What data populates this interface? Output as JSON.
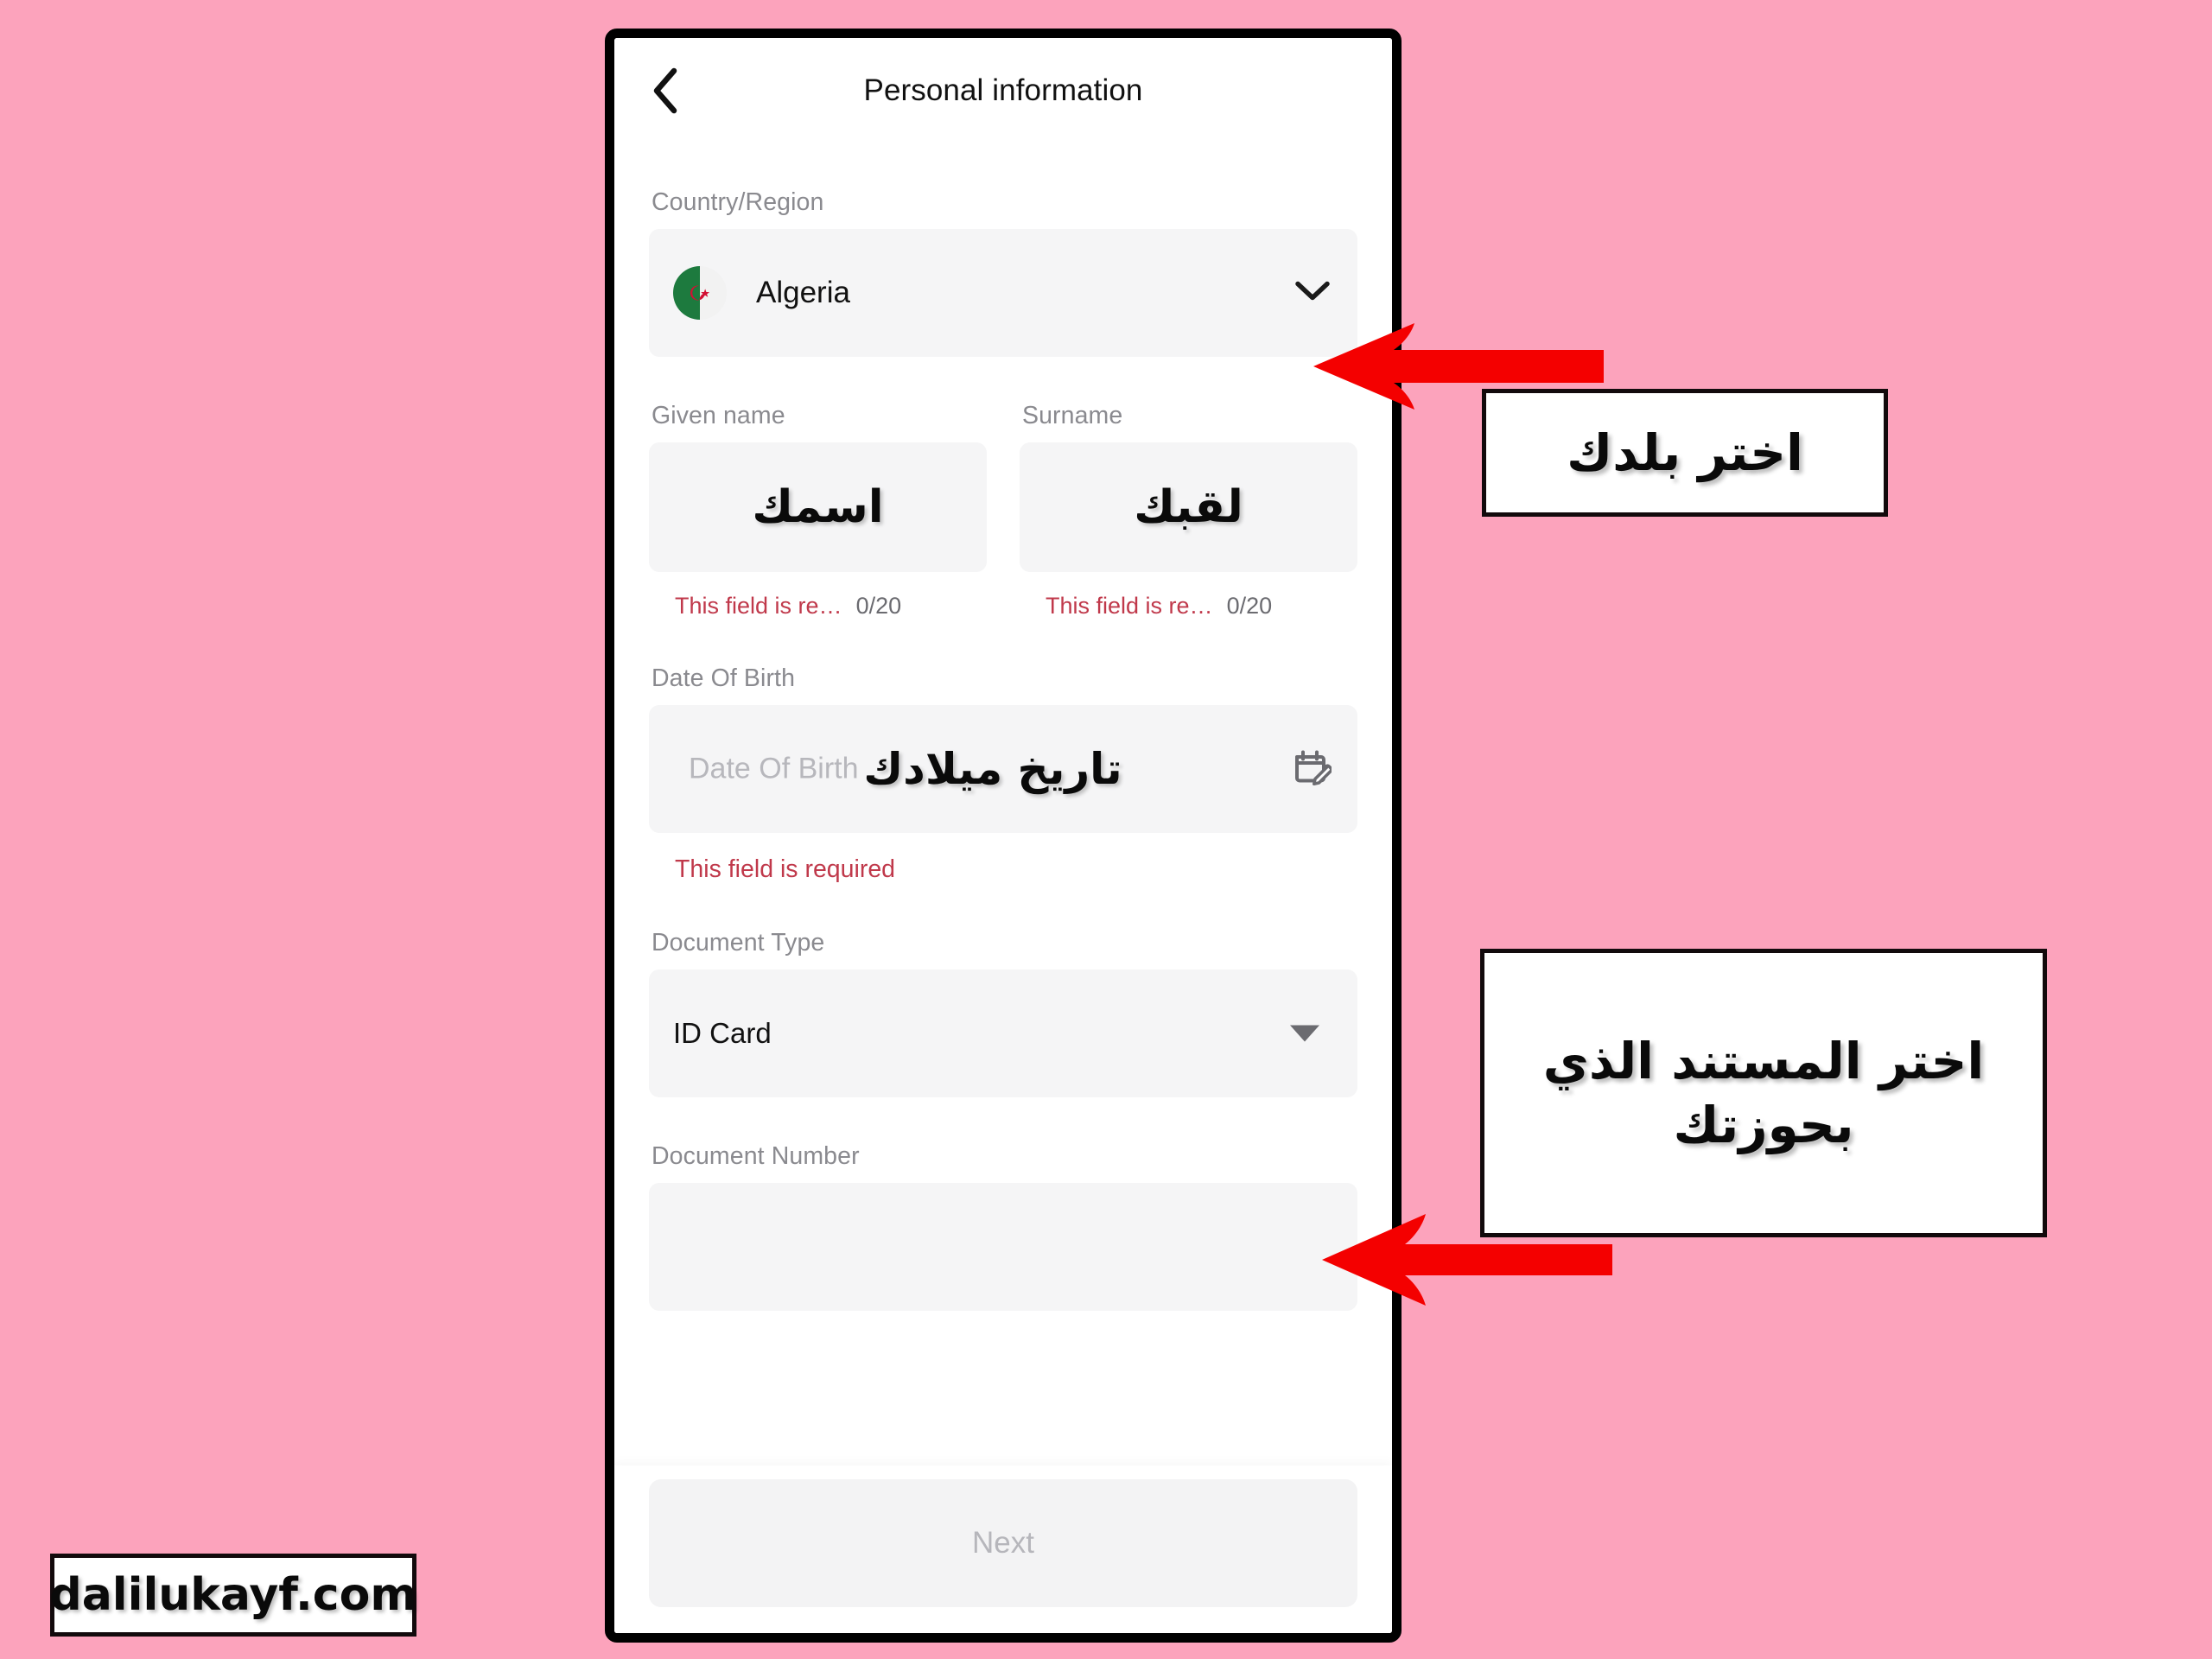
{
  "page": {
    "background_color": "#fca3bc",
    "accent_color": "#f40000",
    "error_color": "#c0394b"
  },
  "app": {
    "header": {
      "back_icon": "chevron-left-icon",
      "title": "Personal information"
    },
    "fields": {
      "country": {
        "label": "Country/Region",
        "value": "Algeria",
        "flag": "algeria-flag-icon",
        "dropdown_icon": "chevron-down-icon"
      },
      "given_name": {
        "label": "Given name",
        "value": "",
        "overlay_text": "اسمك",
        "error": "This field is re…",
        "counter": "0/20"
      },
      "surname": {
        "label": "Surname",
        "value": "",
        "overlay_text": "لقبك",
        "error": "This field is re…",
        "counter": "0/20"
      },
      "date_of_birth": {
        "label": "Date Of Birth",
        "value": "",
        "placeholder": "Date Of Birth",
        "overlay_text": "تاريخ ميلادك",
        "error": "This field is required",
        "icon": "calendar-edit-icon"
      },
      "document_type": {
        "label": "Document Type",
        "value": "ID Card",
        "dropdown_icon": "caret-down-icon"
      },
      "document_number": {
        "label": "Document Number",
        "value": ""
      }
    },
    "next_button": {
      "label": "Next",
      "enabled": false
    }
  },
  "annotations": {
    "country_callout": "اختر بلدك",
    "document_callout": "اختر المستند الذي بحوزتك",
    "arrow_country": "red-arrow-left-icon",
    "arrow_document": "red-arrow-left-icon"
  },
  "watermark": {
    "text": "dalilukayf.com"
  }
}
